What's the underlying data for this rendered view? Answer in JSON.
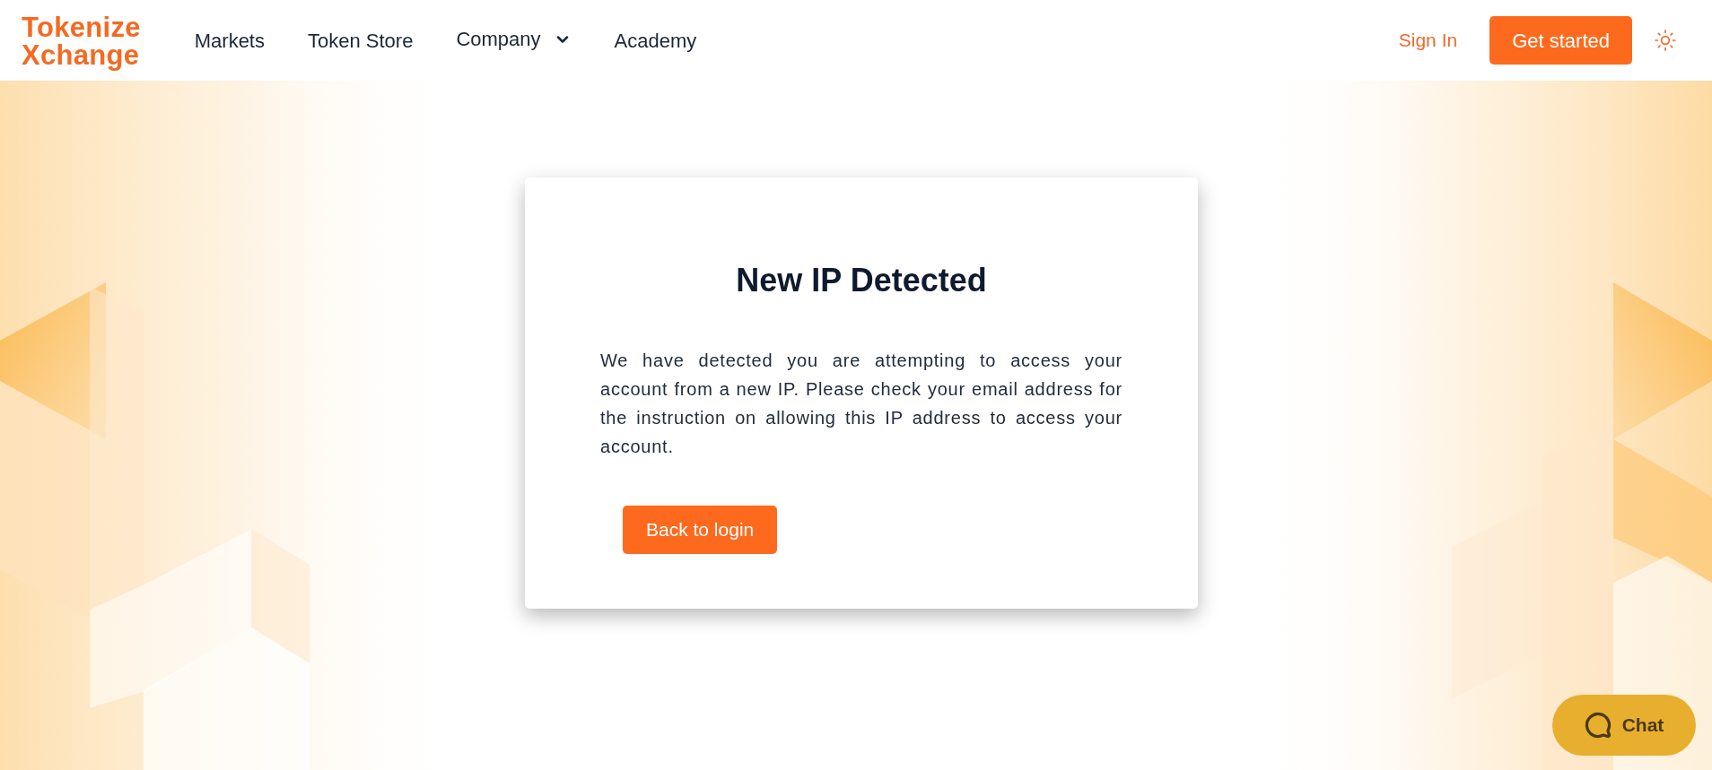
{
  "header": {
    "logo": {
      "line_1": "Tokenize",
      "line_2": "Xchange"
    },
    "nav": [
      {
        "label": "Markets",
        "kind": "link"
      },
      {
        "label": "Token Store",
        "kind": "link"
      },
      {
        "label": "Company",
        "kind": "dropdown"
      },
      {
        "label": "Academy",
        "kind": "link"
      }
    ],
    "sign_in": "Sign In",
    "get_started": "Get started"
  },
  "card": {
    "title": "New IP Detected",
    "message": "We have detected you are attempting to access your account from a new IP. Please check your email address for the instruction on allowing this IP address to access your account.",
    "button": "Back to login"
  },
  "chat": {
    "label": "Chat"
  }
}
